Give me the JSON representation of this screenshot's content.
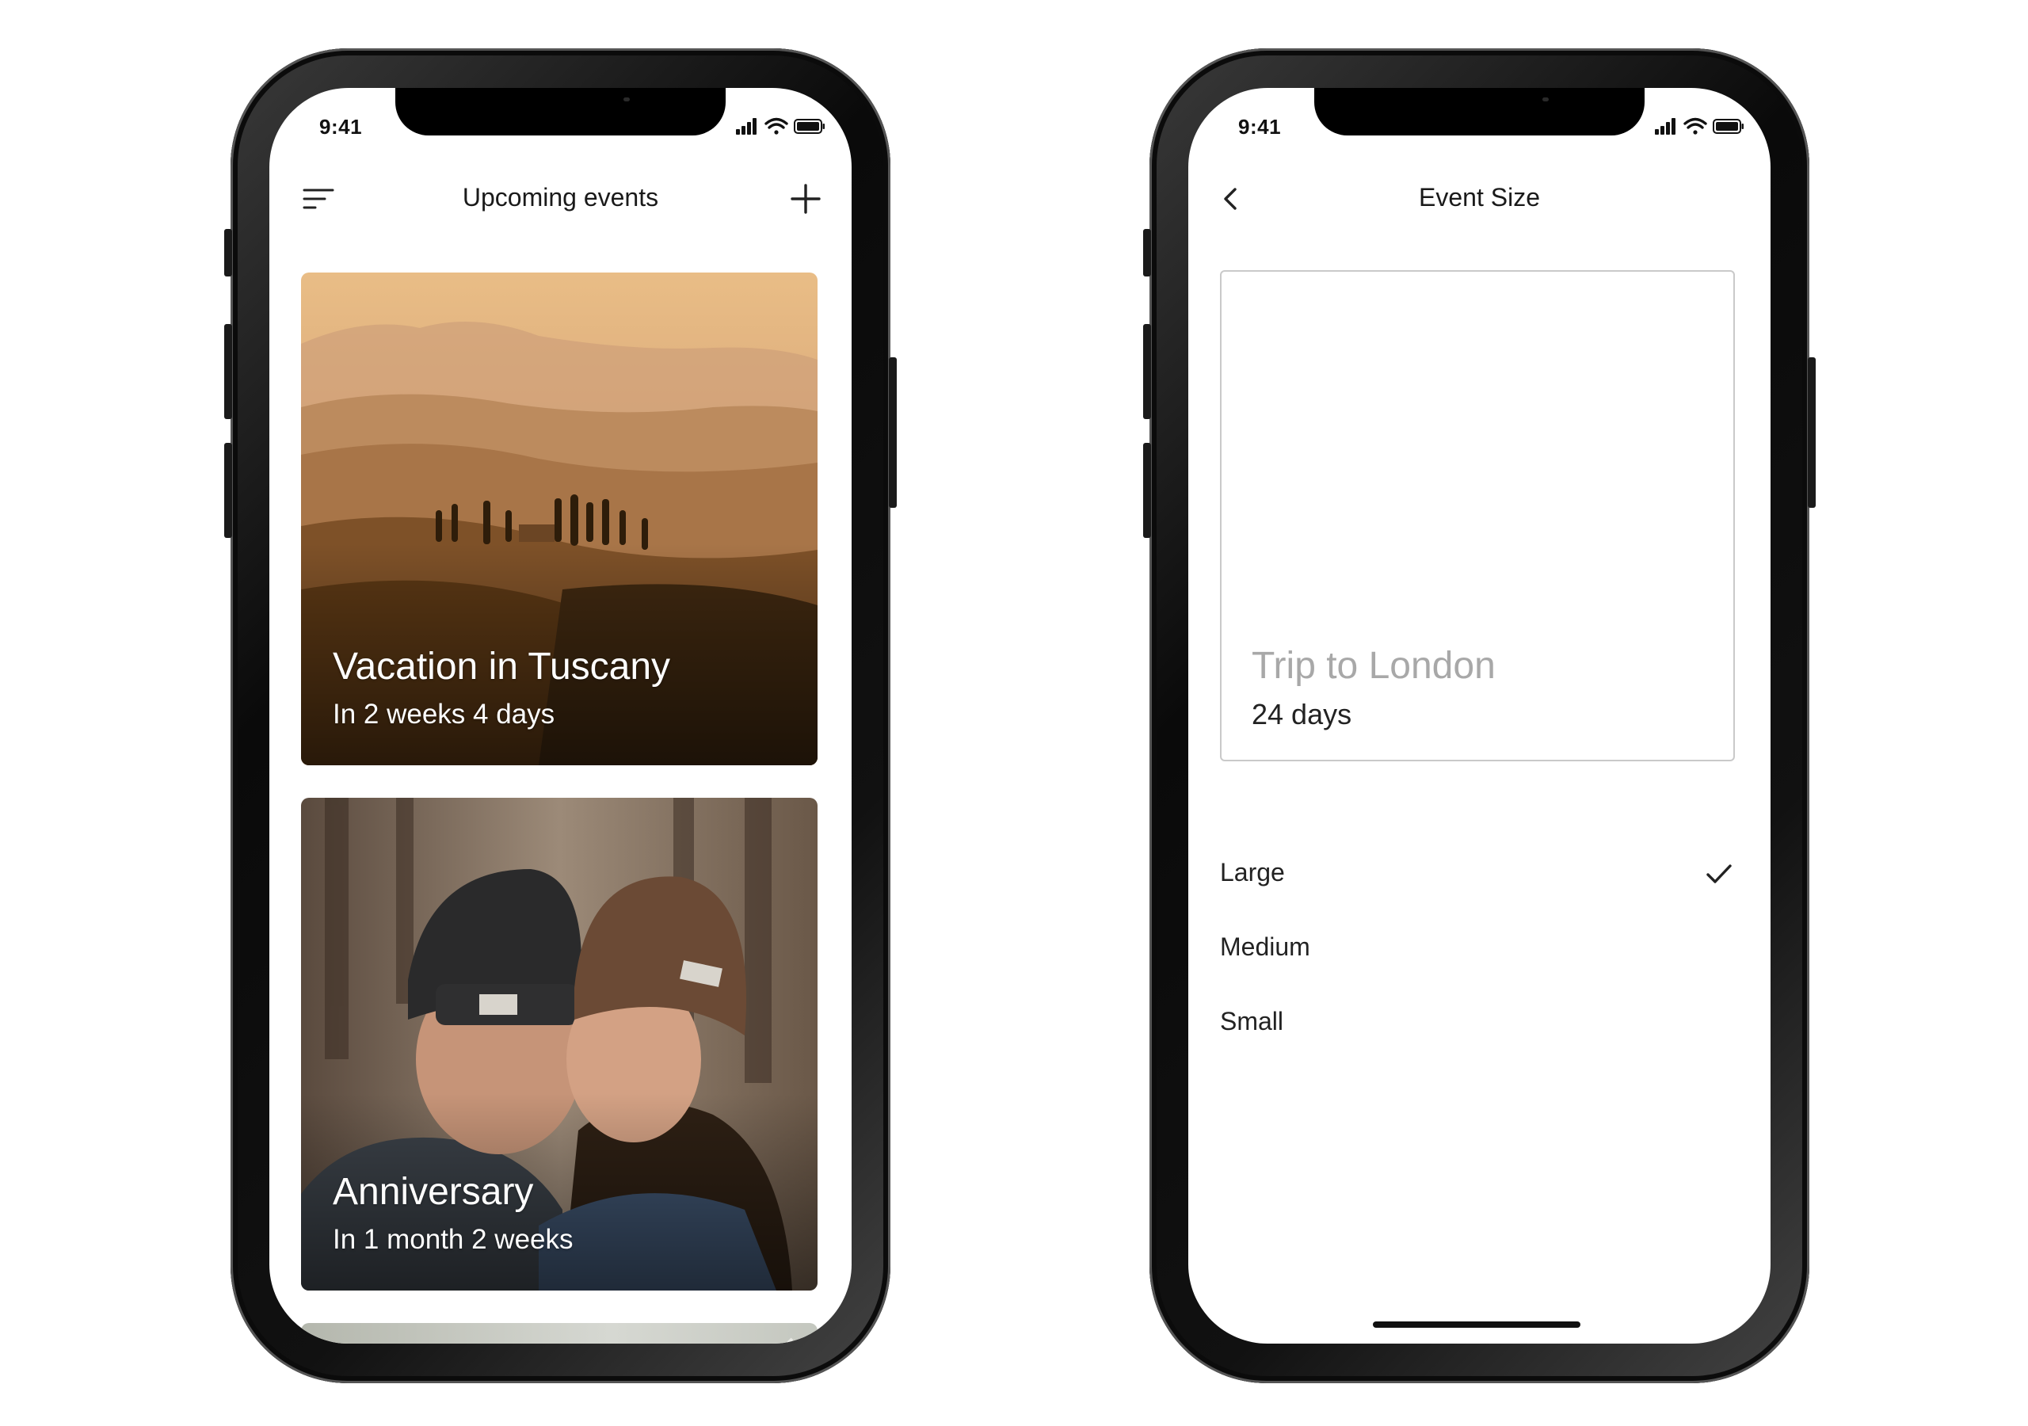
{
  "status_bar": {
    "time": "9:41"
  },
  "events_screen": {
    "title": "Upcoming events",
    "menu_icon": "menu-icon",
    "add_icon": "plus-icon",
    "events": [
      {
        "title": "Vacation in Tuscany",
        "subtitle": "In 2 weeks 4 days"
      },
      {
        "title": "Anniversary",
        "subtitle": "In 1 month 2 weeks"
      }
    ]
  },
  "size_screen": {
    "title": "Event Size",
    "back_icon": "chevron-left-icon",
    "preview": {
      "title": "Trip to London",
      "subtitle": "24 days"
    },
    "options": [
      {
        "label": "Large",
        "selected": true
      },
      {
        "label": "Medium",
        "selected": false
      },
      {
        "label": "Small",
        "selected": false
      }
    ]
  },
  "colors": {
    "frame": "#0a0a0a",
    "screen": "#ffffff",
    "text": "#1a1a1a",
    "placeholder": "#a8a8a8",
    "border": "#c9c9c9"
  }
}
